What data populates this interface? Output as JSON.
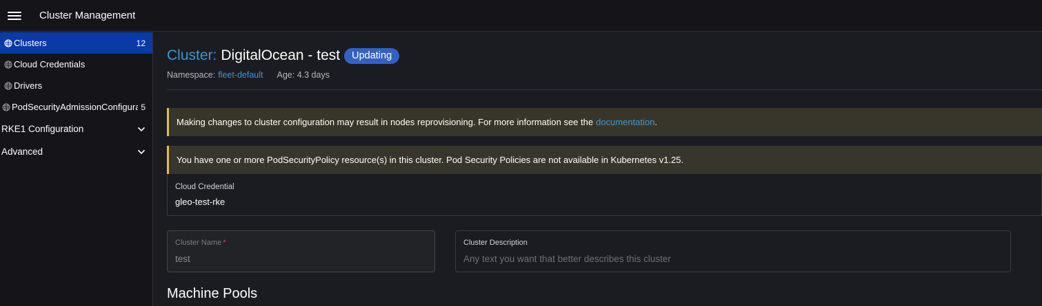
{
  "header": {
    "title": "Cluster Management"
  },
  "sidebar": {
    "items": [
      {
        "label": "Clusters",
        "count": "12",
        "active": true
      },
      {
        "label": "Cloud Credentials",
        "count": ""
      },
      {
        "label": "Drivers",
        "count": ""
      },
      {
        "label": "PodSecurityAdmissionConfigurationTemplates",
        "count": "5"
      }
    ],
    "groups": [
      {
        "label": "RKE1 Configuration"
      },
      {
        "label": "Advanced"
      }
    ]
  },
  "main": {
    "title_prefix": "Cluster:",
    "title_name": "DigitalOcean - test",
    "status_badge": "Updating",
    "namespace_label": "Namespace:",
    "namespace_value": "fleet-default",
    "age": "Age: 4.3 days",
    "banners": [
      {
        "text": "Making changes to cluster configuration may result in nodes reprovisioning. For more information see the",
        "link": "documentation",
        "suffix": "."
      },
      {
        "text": "You have one or more PodSecurityPolicy resource(s) in this cluster. Pod Security Policies are not available in Kubernetes v1.25."
      }
    ],
    "cloud_credential": {
      "label": "Cloud Credential",
      "value": "gleo-test-rke"
    },
    "cluster_name": {
      "label": "Cluster Name",
      "required_mark": "*",
      "value": "test"
    },
    "cluster_description": {
      "label": "Cluster Description",
      "placeholder": "Any text you want that better describes this cluster"
    },
    "section_title": "Machine Pools"
  },
  "colors": {
    "accent_link": "#3d98d3",
    "active_nav": "#0a3aa6",
    "badge": "#3161c5",
    "warning_border": "#e3c04a",
    "required": "#e0454e"
  }
}
